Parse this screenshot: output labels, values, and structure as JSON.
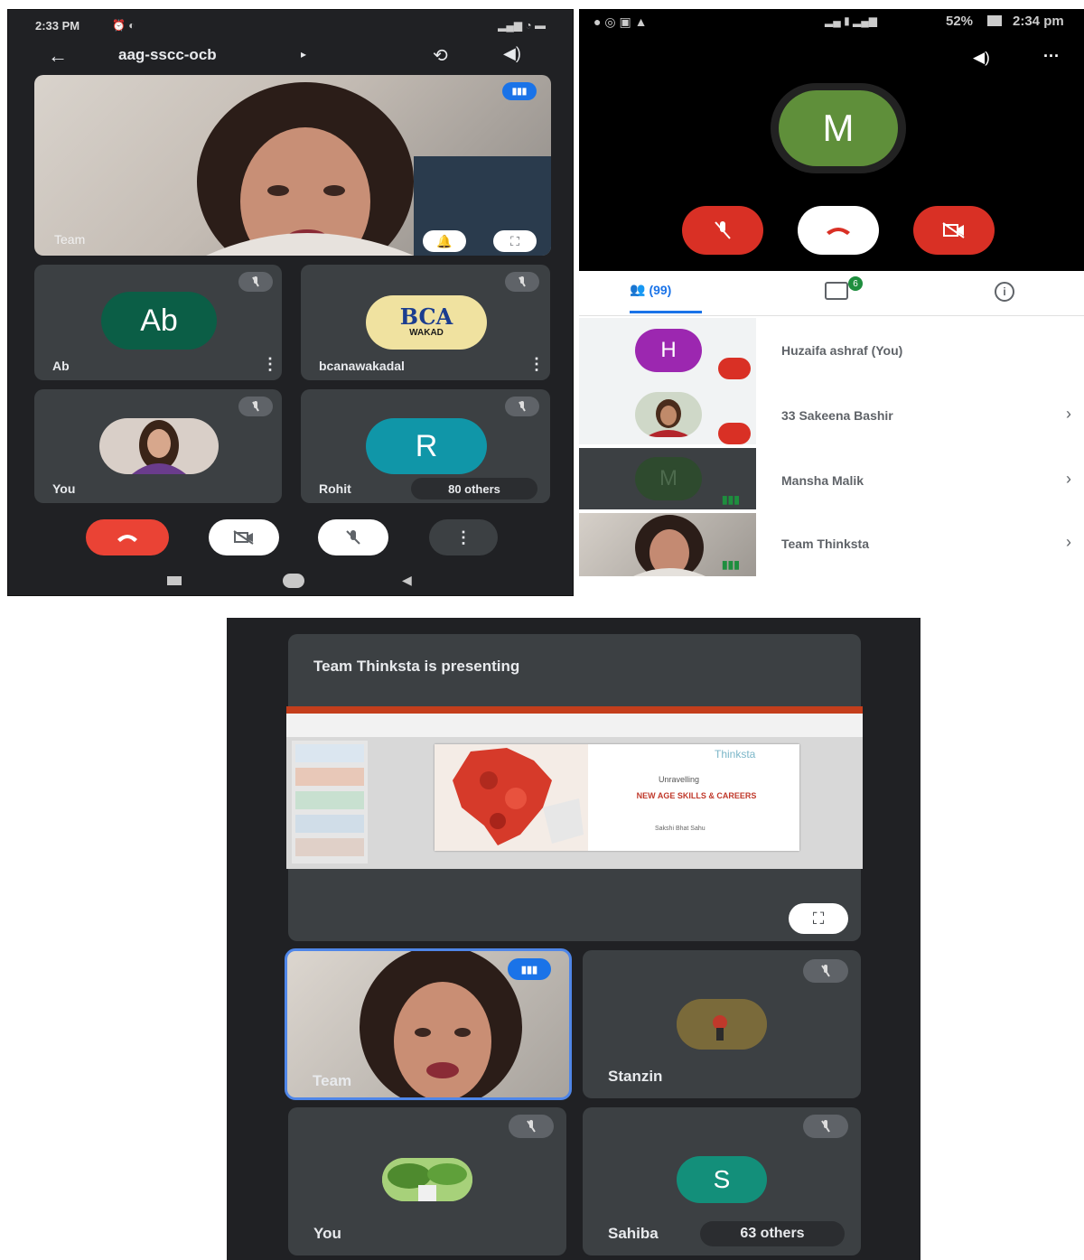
{
  "panel_a": {
    "status_bar": {
      "time": "2:33 PM"
    },
    "header": {
      "meeting_code": "aag-sscc-ocb"
    },
    "main_tile": {
      "name": "Team"
    },
    "tiles": [
      {
        "name": "Ab",
        "initials": "Ab",
        "avatar_color": "#0b5e46"
      },
      {
        "name": "bcanawakadal",
        "logo_text": "BCA",
        "logo_sub": "WAKAD"
      },
      {
        "name": "You"
      },
      {
        "name": "Rohit",
        "initials": "R",
        "avatar_color": "#1096a8",
        "others_label": "80 others"
      }
    ]
  },
  "panel_b": {
    "status_bar": {
      "battery": "52%",
      "time": "2:34 pm"
    },
    "self_avatar": {
      "initial": "M",
      "color": "#5f8f3a"
    },
    "tabs": {
      "people_count": "(99)",
      "chat_badge": "6"
    },
    "participants": [
      {
        "name": "Huzaifa ashraf (You)",
        "initial": "H",
        "avatar_color": "#9c27b0"
      },
      {
        "name": "33 Sakeena Bashir"
      },
      {
        "name": "Mansha Malik",
        "initial": "M",
        "avatar_color": "#2e4a2e"
      },
      {
        "name": "Team Thinksta"
      }
    ]
  },
  "panel_c": {
    "presenting_label": "Team Thinksta is presenting",
    "slide": {
      "brand": "Thinksta",
      "kicker": "Unravelling",
      "title": "NEW AGE SKILLS & CAREERS",
      "presenter": "Sakshi Bhat Sahu"
    },
    "tiles": [
      {
        "name": "Team"
      },
      {
        "name": "Stanzin"
      },
      {
        "name": "You"
      },
      {
        "name": "Sahiba",
        "initials": "S",
        "avatar_color": "#138f7a",
        "others_label": "63 others"
      }
    ]
  },
  "colors": {
    "end_call": "#ea4335",
    "meet_bg": "#202124",
    "tile_bg": "#3c4043",
    "accent_blue": "#1a73e8",
    "speaking_green": "#1e8e3e"
  }
}
